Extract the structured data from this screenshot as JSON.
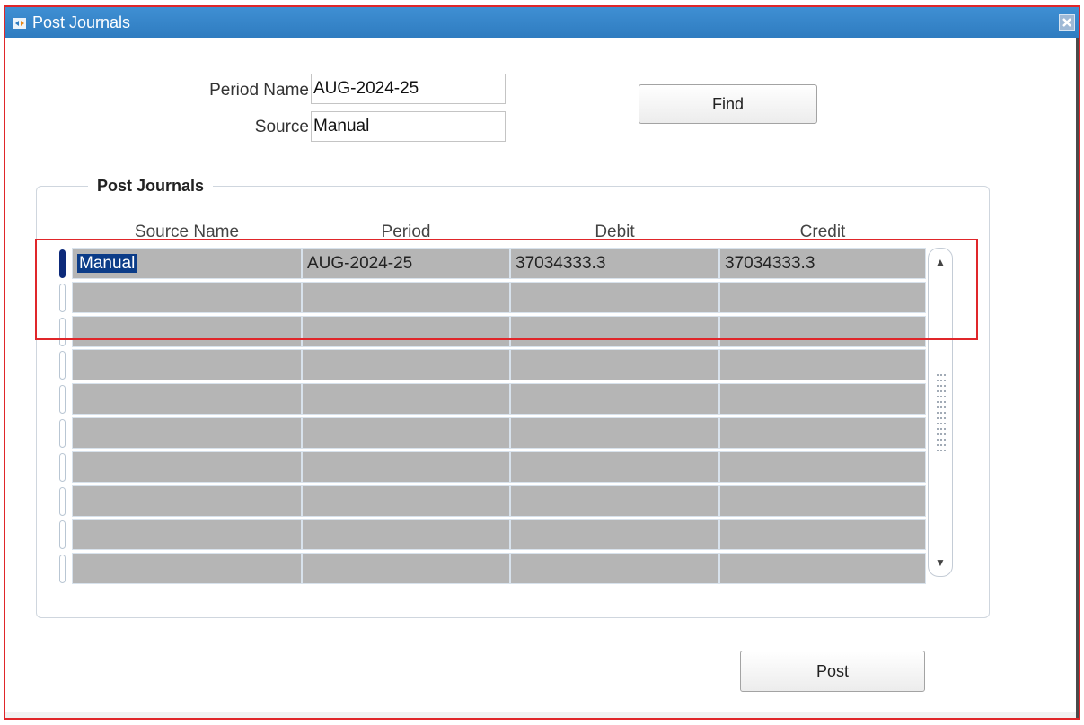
{
  "window": {
    "title": "Post Journals"
  },
  "form": {
    "period_name_label": "Period Name",
    "period_name_value": "AUG-2024-25",
    "source_label": "Source",
    "source_value": "Manual",
    "find_label": "Find"
  },
  "group": {
    "title": "Post Journals",
    "columns": [
      "Source Name",
      "Period",
      "Debit",
      "Credit"
    ],
    "rows": [
      {
        "source_name": "Manual",
        "period": "AUG-2024-25",
        "debit": "37034333.3",
        "credit": "37034333.3"
      },
      {
        "source_name": "",
        "period": "",
        "debit": "",
        "credit": ""
      },
      {
        "source_name": "",
        "period": "",
        "debit": "",
        "credit": ""
      },
      {
        "source_name": "",
        "period": "",
        "debit": "",
        "credit": ""
      },
      {
        "source_name": "",
        "period": "",
        "debit": "",
        "credit": ""
      },
      {
        "source_name": "",
        "period": "",
        "debit": "",
        "credit": ""
      },
      {
        "source_name": "",
        "period": "",
        "debit": "",
        "credit": ""
      },
      {
        "source_name": "",
        "period": "",
        "debit": "",
        "credit": ""
      },
      {
        "source_name": "",
        "period": "",
        "debit": "",
        "credit": ""
      },
      {
        "source_name": "",
        "period": "",
        "debit": "",
        "credit": ""
      }
    ]
  },
  "post_label": "Post",
  "icons": {
    "title": "oracle-forms-icon",
    "close": "close-icon",
    "scroll_up": "arrow-up-icon",
    "scroll_down": "arrow-down-icon"
  },
  "colors": {
    "titlebar": "#2f7cc0",
    "highlight": "#e0262a",
    "selection": "#0b3c88",
    "cell": "#b5b5b5"
  }
}
